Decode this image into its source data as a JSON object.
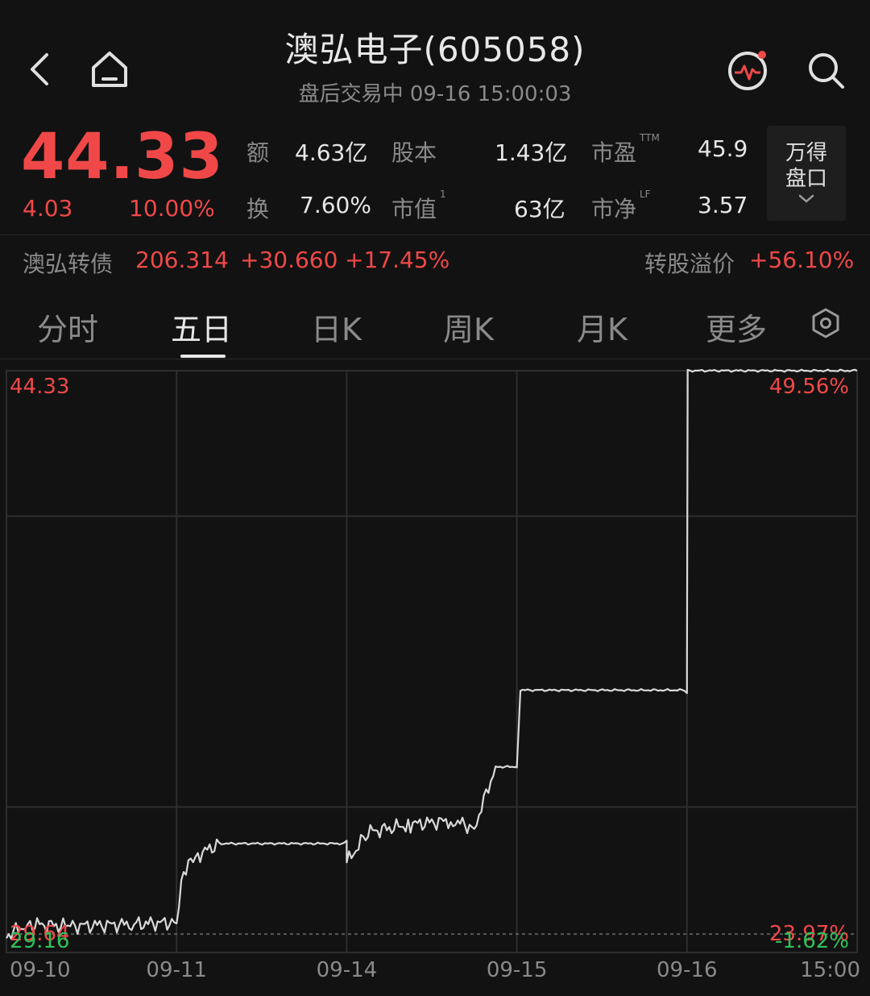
{
  "header": {
    "title": "澳弘电子(605058)",
    "subtitle": "盘后交易中 09-16 15:00:03"
  },
  "quote": {
    "price": "44.33",
    "change": "4.03",
    "change_pct": "10.00%",
    "stats": {
      "amount_label": "额",
      "amount": "4.63亿",
      "share_capital_label": "股本",
      "share_capital": "1.43亿",
      "pe_label": "市盈",
      "pe_sup": "TTM",
      "pe": "45.9",
      "turnover_label": "换",
      "turnover": "7.60%",
      "mkt_cap_label": "市值",
      "mkt_cap_sup": "1",
      "mkt_cap": "63亿",
      "pb_label": "市净",
      "pb_sup": "LF",
      "pb": "3.57"
    },
    "panel_button": {
      "line1": "万得",
      "line2": "盘口"
    }
  },
  "convertible_bond": {
    "name": "澳弘转债",
    "price": "206.314",
    "change": "+30.660",
    "change_pct": "+17.45%",
    "premium_label": "转股溢价",
    "premium": "+56.10%"
  },
  "tabs": [
    {
      "label": "分时"
    },
    {
      "label": "五日"
    },
    {
      "label": "日K"
    },
    {
      "label": "周K"
    },
    {
      "label": "月K"
    },
    {
      "label": "更多"
    }
  ],
  "active_tab": "五日",
  "colors": {
    "up": "#f04848",
    "down": "#2ec25a",
    "line": "#d9d9d9",
    "grid": "#2e2e2e",
    "bg": "#121212"
  },
  "chart_data": {
    "type": "line",
    "y_left_ticks": [
      "44.33",
      "29.64",
      "29.16"
    ],
    "y_right_ticks": [
      "49.56%",
      "23.97%",
      "-1.62%"
    ],
    "x_ticks": [
      "09-10",
      "09-11",
      "09-14",
      "09-15",
      "09-16",
      "15:00"
    ],
    "ylim": [
      29.16,
      44.33
    ],
    "reference_price": 29.64,
    "series": [
      {
        "x": [
          "09-10 09:30",
          "09-10 10:00",
          "09-10 11:00",
          "09-10 14:00",
          "09-10 15:00",
          "09-11 09:40",
          "09-11 10:00",
          "09-11 10:30",
          "09-11 15:00",
          "09-14 09:30",
          "09-14 10:00",
          "09-14 11:00",
          "09-14 13:30",
          "09-14 14:00",
          "09-14 14:30",
          "09-14 15:00",
          "09-15 09:30",
          "09-15 09:35",
          "09-15 15:00",
          "09-16 09:30",
          "09-16 09:31",
          "09-16 15:00"
        ],
        "values": [
          29.6,
          29.9,
          29.85,
          29.9,
          29.95,
          31.3,
          31.7,
          32.0,
          32.0,
          31.5,
          32.3,
          32.5,
          32.6,
          32.4,
          34.0,
          34.0,
          34.0,
          36.0,
          36.0,
          36.6,
          44.33,
          44.33
        ]
      }
    ]
  }
}
